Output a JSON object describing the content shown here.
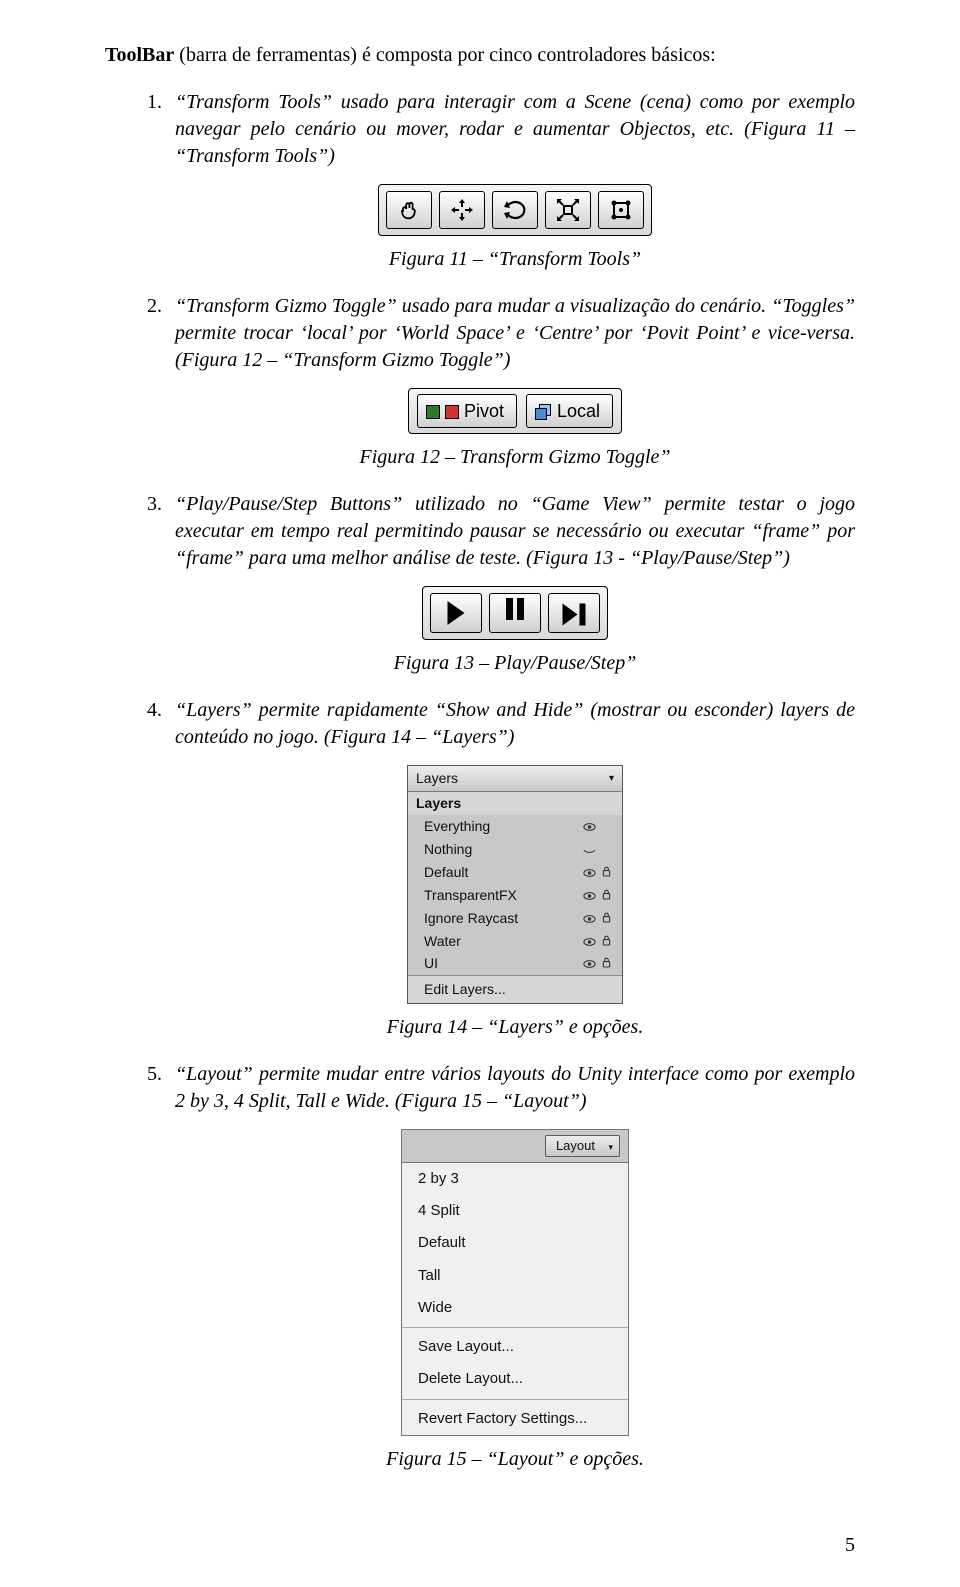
{
  "intro": {
    "bold": "ToolBar",
    "rest": " (barra de ferramentas) é composta por cinco controladores básicos:"
  },
  "items": [
    {
      "p": "“Transform Tools” usado para interagir com a Scene (cena) como por exemplo navegar pelo cenário ou mover, rodar e aumentar Objectos, etc. (Figura 11 – “Transform Tools”)",
      "caption": "Figura 11 – “Transform Tools”"
    },
    {
      "p": "“Transform Gizmo Toggle” usado para mudar a visualização do cenário. “Toggles” permite trocar ‘local’ por ‘World Space’ e ‘Centre’ por ‘Povit Point’ e vice-versa. (Figura 12 – “Transform Gizmo Toggle”)",
      "caption": "Figura 12 – Transform Gizmo Toggle”",
      "btnPivot": "Pivot",
      "btnLocal": "Local"
    },
    {
      "p": "“Play/Pause/Step Buttons” utilizado no “Game View” permite testar o jogo executar em tempo real permitindo pausar se necessário ou executar “frame” por “frame” para uma melhor análise de teste. (Figura 13 - “Play/Pause/Step”)",
      "caption": "Figura 13 – Play/Pause/Step”"
    },
    {
      "p": "“Layers” permite rapidamente “Show and Hide” (mostrar ou esconder) layers de conteúdo no jogo. (Figura 14 – “Layers”)",
      "caption": "Figura 14 – “Layers” e opções.",
      "panel": {
        "header": "Layers",
        "section": "Layers",
        "rows": [
          {
            "label": "Everything",
            "eye": true,
            "lock": false
          },
          {
            "label": "Nothing",
            "eye": false,
            "lock": false
          },
          {
            "label": "Default",
            "eye": true,
            "lock": true
          },
          {
            "label": "TransparentFX",
            "eye": true,
            "lock": true
          },
          {
            "label": "Ignore Raycast",
            "eye": true,
            "lock": true
          },
          {
            "label": "Water",
            "eye": true,
            "lock": true
          },
          {
            "label": "UI",
            "eye": true,
            "lock": true
          }
        ],
        "edit": "Edit Layers..."
      }
    },
    {
      "p": "“Layout” permite mudar entre vários layouts do Unity interface como por exemplo 2 by 3, 4 Split, Tall e Wide. (Figura 15 – “Layout”)",
      "caption": "Figura 15 – “Layout” e opções.",
      "dd": "Layout",
      "menu": [
        "2 by 3",
        "4 Split",
        "Default",
        "Tall",
        "Wide",
        "",
        "Save Layout...",
        "Delete Layout...",
        "",
        "Revert Factory Settings..."
      ]
    }
  ],
  "pageNumber": "5"
}
